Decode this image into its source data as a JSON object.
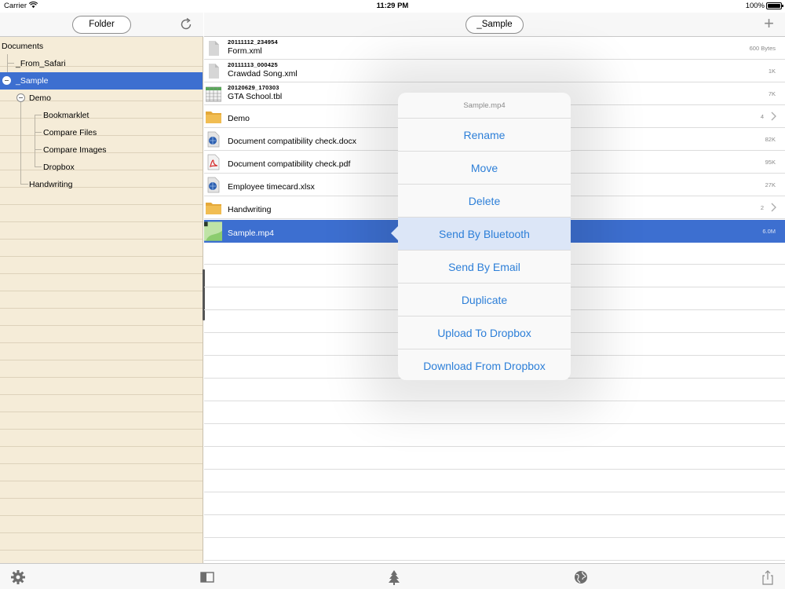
{
  "status_bar": {
    "carrier": "Carrier",
    "time": "11:29 PM",
    "battery": "100%"
  },
  "left_header": {
    "folder_button": "Folder",
    "refresh_icon": "refresh-icon"
  },
  "tree": {
    "items": [
      {
        "label": "Documents"
      },
      {
        "label": "_From_Safari"
      },
      {
        "label": "_Sample",
        "selected": true
      },
      {
        "label": "Demo"
      },
      {
        "label": "Bookmarklet"
      },
      {
        "label": "Compare Files"
      },
      {
        "label": "Compare Images"
      },
      {
        "label": "Dropbox"
      },
      {
        "label": "Handwriting"
      }
    ]
  },
  "right_header": {
    "path_button": "_Sample",
    "add_icon": "plus-icon"
  },
  "files": [
    {
      "date": "20111112_234954",
      "name": "Form.xml",
      "size": "600 Bytes",
      "icon": "document-icon"
    },
    {
      "date": "20111113_000425",
      "name": "Crawdad Song.xml",
      "size": "1K",
      "icon": "document-icon"
    },
    {
      "date": "20120629_170303",
      "name": "GTA School.tbl",
      "size": "7K",
      "icon": "table-icon"
    },
    {
      "name": "Demo",
      "count": "4",
      "icon": "folder-icon"
    },
    {
      "name": "Document compatibility check.docx",
      "size": "82K",
      "icon": "web-document-icon"
    },
    {
      "name": "Document compatibility check.pdf",
      "size": "95K",
      "icon": "pdf-icon"
    },
    {
      "name": "Employee timecard.xlsx",
      "size": "27K",
      "icon": "web-document-icon"
    },
    {
      "name": "Handwriting",
      "count": "2",
      "icon": "folder-icon"
    },
    {
      "name": "Sample.mp4",
      "size": "6.0M",
      "icon": "video-thumbnail-icon",
      "selected": true
    }
  ],
  "popover": {
    "title": "Sample.mp4",
    "actions": [
      "Rename",
      "Move",
      "Delete",
      "Send By Bluetooth",
      "Send By Email",
      "Duplicate",
      "Upload To Dropbox",
      "Download From Dropbox"
    ],
    "highlighted": "Send By Bluetooth"
  },
  "toolbar": {
    "icons": [
      "gear-icon",
      "sidebar-icon",
      "tree-icon",
      "globe-icon",
      "share-icon"
    ]
  },
  "colors": {
    "accent": "#2d7fd8",
    "selection": "#3d6fd0",
    "paper": "#f5ecd8"
  }
}
